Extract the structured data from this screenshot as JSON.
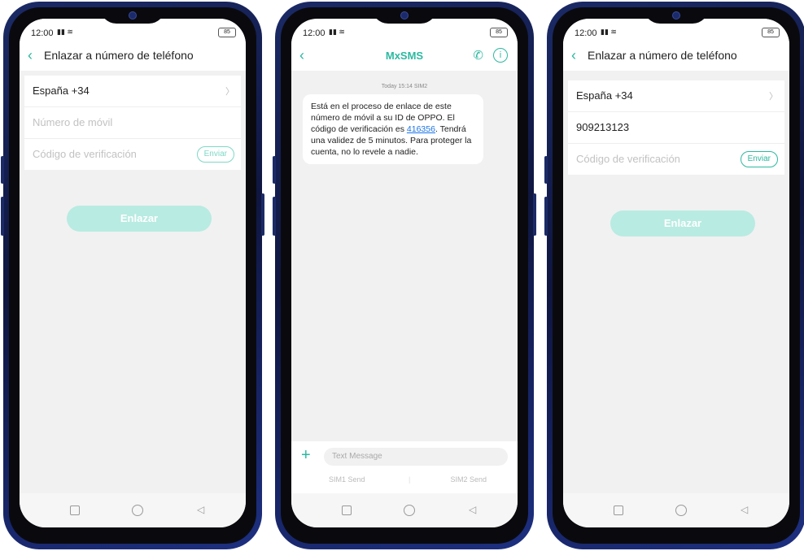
{
  "status": {
    "time": "12:00",
    "battery": "85"
  },
  "screen1": {
    "title": "Enlazar a número de teléfono",
    "country": "España +34",
    "phone_placeholder": "Número de móvil",
    "code_placeholder": "Código de verificación",
    "send_label": "Enviar",
    "bind_label": "Enlazar"
  },
  "screen2": {
    "title": "MxSMS",
    "timestamp": "Today 15:14  SIM2",
    "msg_before": "Está en el proceso de enlace de este número de móvil a su ID de OPPO. El código de verificación es ",
    "code": "416356",
    "msg_after": ". Tendrá una validez de 5 minutos. Para proteger la cuenta, no lo revele a nadie.",
    "compose_placeholder": "Text Message",
    "sim1": "SIM1 Send",
    "sim2": "SIM2 Send"
  },
  "screen3": {
    "title": "Enlazar a número de teléfono",
    "country": "España +34",
    "phone_value": "909213123",
    "code_placeholder": "Código de verificación",
    "send_label": "Enviar",
    "bind_label": "Enlazar"
  },
  "icons": {
    "back": "chevron-left-icon",
    "call": "phone-icon",
    "info": "info-icon",
    "add": "plus-icon"
  },
  "colors": {
    "accent": "#2cb9a0",
    "button_disabled": "#b8ebe1",
    "link": "#1a73e8"
  }
}
